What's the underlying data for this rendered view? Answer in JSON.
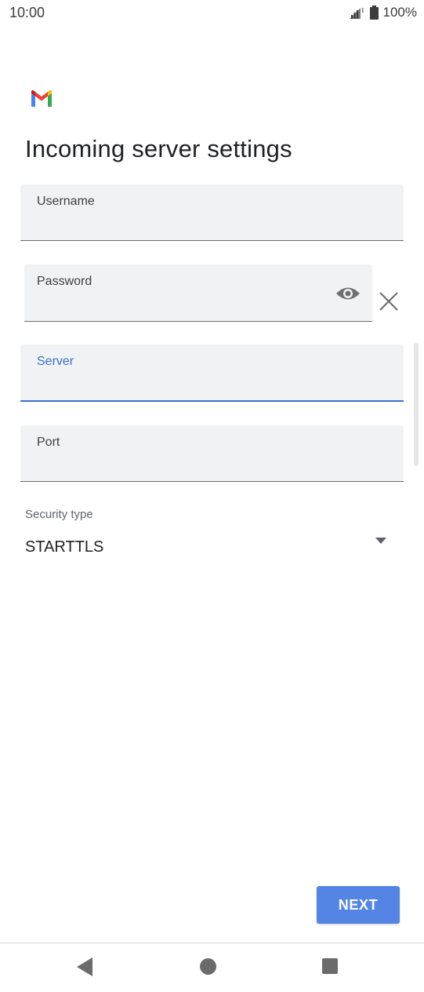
{
  "status_bar": {
    "time": "10:00",
    "battery": "100%",
    "icons": [
      "signal-icon",
      "battery-icon"
    ]
  },
  "app": {
    "logo": "gmail-logo"
  },
  "page": {
    "title": "Incoming server settings"
  },
  "form": {
    "username": {
      "label": "Username",
      "value": ""
    },
    "password": {
      "label": "Password",
      "value": ""
    },
    "server": {
      "label": "Server",
      "value": ""
    },
    "port": {
      "label": "Port",
      "value": ""
    },
    "security": {
      "label": "Security type",
      "value": "STARTTLS"
    }
  },
  "actions": {
    "next_label": "NEXT"
  },
  "colors": {
    "accent": "#3d6fd0",
    "button": "#5485e5",
    "field_bg": "#f1f2f4"
  }
}
